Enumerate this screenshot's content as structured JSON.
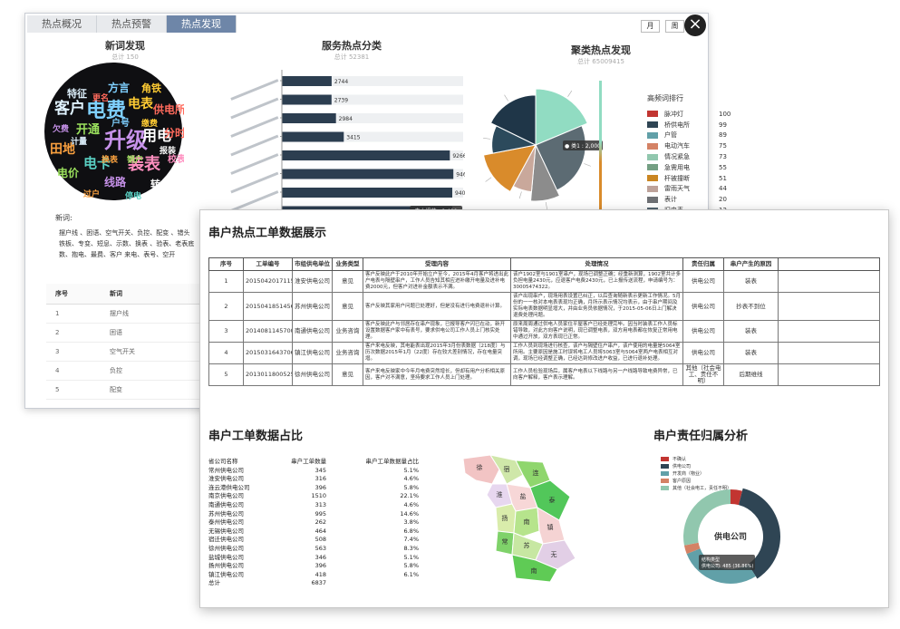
{
  "back_window": {
    "tabs": [
      {
        "label": "热点概况",
        "active": false
      },
      {
        "label": "热点预警",
        "active": false
      },
      {
        "label": "热点发现",
        "active": true
      }
    ],
    "period_buttons": [
      "月",
      "周"
    ],
    "close_symbol": "×",
    "new_words_panel": {
      "title": "新词发现",
      "subtitle": "总计 150",
      "cloud_words": [
        "客户",
        "电费",
        "电表",
        "供电所",
        "开通",
        "升级",
        "用电",
        "田地",
        "电卡",
        "装表",
        "特征",
        "方言",
        "角铁",
        "分时",
        "电价",
        "线路",
        "转供",
        "过户",
        "停电",
        "校表",
        "计量",
        "户号",
        "缴费",
        "更名",
        "销户",
        "欠费",
        "报装",
        "换表"
      ],
      "new_words_label": "新词:",
      "new_words_text": "摆户线 、困语、空气开关、负控、配变 、错头铁板、专变、短息、示数、换表 、验表、老表底数、抱电、最费、客户 来电、表号、空开",
      "table_headers": [
        "序号",
        "新词"
      ],
      "table_rows": [
        [
          "1",
          "摆户线"
        ],
        [
          "2",
          "困语"
        ],
        [
          "3",
          "空气开关"
        ],
        [
          "4",
          "负控"
        ],
        [
          "5",
          "配变"
        ]
      ]
    },
    "service_panel": {
      "title": "服务热点分类",
      "subtitle": "总计 52381",
      "bar_color": "#2c3e50",
      "tooltip": "电力报装 : 9,400"
    },
    "cluster_panel": {
      "title": "聚类热点发现",
      "subtitle": "总计 65009415",
      "pie_tooltip": "● 类1 : 2,000",
      "rank_title": "高频词排行",
      "rank_items": [
        {
          "name": "脉冲灯",
          "value": "100",
          "color": "#c23531"
        },
        {
          "name": "桥供电所",
          "value": "99",
          "color": "#2f4554"
        },
        {
          "name": "户管",
          "value": "89",
          "color": "#61a0a8"
        },
        {
          "name": "电动汽车",
          "value": "75",
          "color": "#d48265"
        },
        {
          "name": "情况紧急",
          "value": "73",
          "color": "#91c7ae"
        },
        {
          "name": "急需用电",
          "value": "55",
          "color": "#749f83"
        },
        {
          "name": "杆被撞断",
          "value": "51",
          "color": "#ca8622"
        },
        {
          "name": "雷雨天气",
          "value": "44",
          "color": "#bda29a"
        },
        {
          "name": "表计",
          "value": "20",
          "color": "#6e7074"
        },
        {
          "name": "旧电表",
          "value": "12",
          "color": "#546570"
        }
      ]
    }
  },
  "front_window": {
    "title": "串户热点工单数据展示",
    "work_order_headers": [
      "序号",
      "工单编号",
      "市组供电单位",
      "业务类型",
      "受理内容",
      "处理情况",
      "责任归属",
      "串户产生的原因"
    ],
    "work_orders": [
      {
        "no": "1",
        "id": "20150420171151",
        "unit": "淮安供电公司",
        "type": "意见",
        "content": "客户反映此户于2010年开始立户至今，2015年4月客户将进出此户电表与隔壁串户，工作人员告知其相应进补缴开电量及进补电费2000元，但客户对进补金额表示不满。",
        "handling": "该户1902室与1901室串户，现场已调整正确；经重新测算，1902室共计多负担电量2430元，应退客户电费2430元，已上报传送流程，申请编号为：30005474322。",
        "resp": "供电公司",
        "reason": "装表"
      },
      {
        "no": "2",
        "id": "20150418514568",
        "unit": "苏州供电公司",
        "type": "意见",
        "content": "客户反映其家用户问题已处理好，但是没有进行电费退补计算。",
        "handling": "该户出现串户，现场用表设置已纠正，以后查询随新表示更新工作情况。5月份的一一核对本电表表现均正确，月所示表示情况均表示，由于串户期间及实际电表数据明显增大，并由业务员依据情况，于2015-05-06日上门解决退费处理问题。",
        "resp": "供电公司",
        "reason": "抄表不到位"
      },
      {
        "no": "3",
        "id": "20140811457000",
        "unit": "南通供电公司",
        "type": "业务咨询",
        "content": "客户反映此户与邻居存在串户现象，已报导客户闪已在动，新开设置数据客户家中有表号，要求供电公司工作人员上门核实处理。",
        "handling": "原来周周通过供电人员家住平屋客户已经处理完毕。因当时装表工作人员标错导致，对此方向客户说明，现已调整电表，双方用电表都在恢复正常用电中通过开放，双方表现已正常。",
        "resp": "供电公司",
        "reason": "装表"
      },
      {
        "no": "4",
        "id": "20150316437063",
        "unit": "镇江供电公司",
        "type": "业务咨询",
        "content": "客户来电反映，其电能表出现2015年3月份表数据（218度）与历次数据2015年1月（22度）存在较大差别情况，存在电量突增。",
        "handling": "工作人员到现场进行核查，该户与隔壁住户串户，该户使用的电量是5064室所用。主要原因是施工时误将电工人员将5063室与5064室两户电表相互对调，现场已经调整正确，已经达到修改进户收益，已进行退补处理。",
        "resp": "供电公司",
        "reason": "装表"
      },
      {
        "no": "5",
        "id": "20130118005250",
        "unit": "徐州供电公司",
        "type": "意见",
        "content": "客户来电反映家中今年月电费突然增长，但却有用户分析相关原因，客户对不满意，坚持要求工作人员上门处理。",
        "handling": "工作人员检验现场后，属客户电表以下线路与另一户线路导致电费异常，已向客户解释，客户表示理解。",
        "resp": "其他（社会电工、责任不明）",
        "reason": "后期维线"
      }
    ],
    "ratio_title": "串户工单数据占比",
    "ratio_headers": [
      "省公司名称",
      "串户工单数量",
      "串户工单数据量占比"
    ],
    "ratio_rows": [
      [
        "常州供电公司",
        "345",
        "5.1%"
      ],
      [
        "淮安供电公司",
        "316",
        "4.6%"
      ],
      [
        "连云港供电公司",
        "396",
        "5.8%"
      ],
      [
        "南京供电公司",
        "1510",
        "22.1%"
      ],
      [
        "南通供电公司",
        "313",
        "4.6%"
      ],
      [
        "苏州供电公司",
        "995",
        "14.6%"
      ],
      [
        "泰州供电公司",
        "262",
        "3.8%"
      ],
      [
        "无锡供电公司",
        "464",
        "6.8%"
      ],
      [
        "宿迁供电公司",
        "508",
        "7.4%"
      ],
      [
        "徐州供电公司",
        "563",
        "8.3%"
      ],
      [
        "盐城供电公司",
        "346",
        "5.1%"
      ],
      [
        "扬州供电公司",
        "396",
        "5.8%"
      ],
      [
        "镇江供电公司",
        "418",
        "6.1%"
      ]
    ],
    "ratio_total": [
      "总计",
      "6837"
    ],
    "map_labels": [
      "徐",
      "宿",
      "连",
      "淮",
      "盐",
      "泰",
      "扬",
      "南",
      "镇",
      "常",
      "苏",
      "无",
      "南"
    ],
    "resp_title": "串户责任归属分析",
    "resp_legend": [
      {
        "label": "不确认",
        "color": "#c23531"
      },
      {
        "label": "供电公司",
        "color": "#2f4554"
      },
      {
        "label": "开发商（物业）",
        "color": "#61a0a8"
      },
      {
        "label": "客户原因",
        "color": "#d48265"
      },
      {
        "label": "其他（社会电工，责任不明）",
        "color": "#91c7ae"
      }
    ],
    "donut_center": "供电公司",
    "donut_tooltip_1": "结构类型",
    "donut_tooltip_2": "供电公司: 485 (36.86%)"
  },
  "chart_data": [
    {
      "type": "bar",
      "title": "服务热点分类",
      "orientation": "horizontal",
      "values": [
        2744,
        2739,
        2984,
        3415,
        9266,
        9460,
        9400,
        9400
      ],
      "xlim": [
        0,
        10000
      ]
    },
    {
      "type": "pie",
      "title": "聚类热点发现",
      "labels": [
        "类1"
      ],
      "values": [
        2000,
        2600,
        900,
        700,
        1500,
        1100,
        1900
      ],
      "colors": [
        "#91dcc2",
        "#5c6b73",
        "#8c8c8c",
        "#c9a89b",
        "#d98b2b",
        "#2c4a5c",
        "#1f3648"
      ]
    },
    {
      "type": "pie",
      "title": "串户责任归属分析",
      "values": [
        4,
        37,
        28,
        3,
        28
      ],
      "colors": [
        "#c23531",
        "#2f4554",
        "#61a0a8",
        "#d48265",
        "#91c7ae"
      ]
    }
  ]
}
